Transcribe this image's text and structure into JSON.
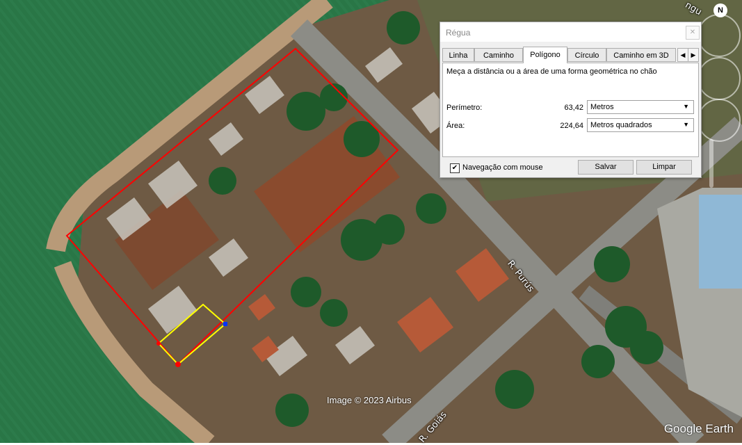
{
  "map": {
    "streets": [
      "R. Purús",
      "R. Goiás",
      "ngu"
    ],
    "credit": "Image © 2023 Airbus",
    "brand": "Google Earth",
    "compass": "N"
  },
  "dialog": {
    "title": "Régua",
    "close_icon": "close-icon",
    "tabs": [
      "Linha",
      "Caminho",
      "Polígono",
      "Círculo",
      "Caminho em 3D"
    ],
    "active_tab": "Polígono",
    "description": "Meça a distância ou a área de uma forma geométrica no chão",
    "perimeter": {
      "label": "Perímetro:",
      "value": "63,42",
      "unit": "Metros"
    },
    "area": {
      "label": "Área:",
      "value": "224,64",
      "unit": "Metros quadrados"
    },
    "mouse_nav": {
      "label": "Navegação com mouse",
      "checked": true
    },
    "save_label": "Salvar",
    "clear_label": "Limpar"
  },
  "colors": {
    "polygon_outline": "#ff0000",
    "measure_polygon": "#ffff00",
    "dialog_bg": "#f0f0f0"
  }
}
